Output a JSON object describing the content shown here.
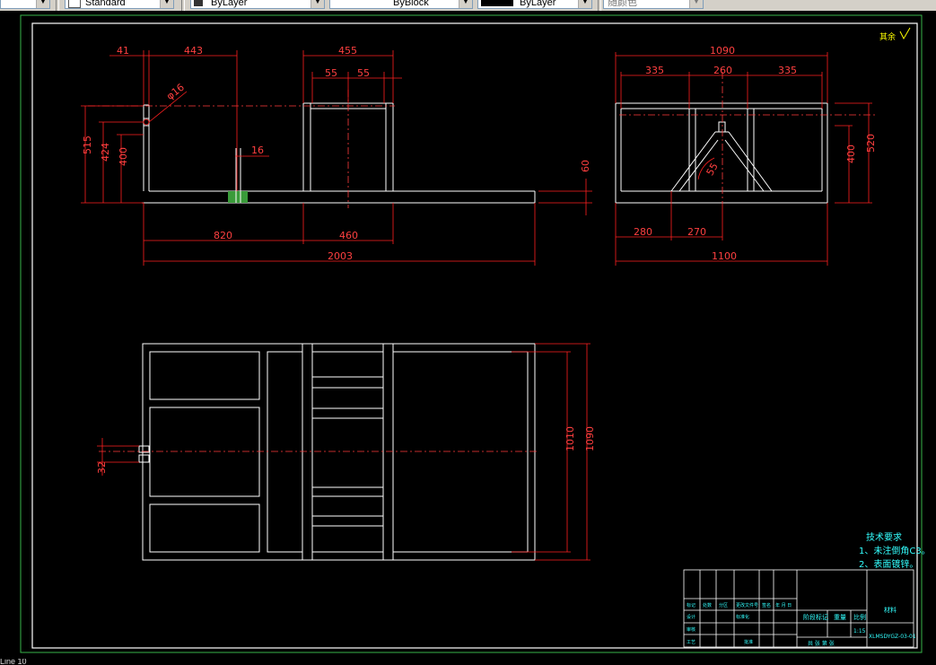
{
  "toolbar": {
    "text_style": "Standard",
    "layer": "ByLayer",
    "linetype": "ByBlock",
    "lineweight": "ByLayer",
    "plotstyle": "随颜色"
  },
  "drawing": {
    "roughness_mark": "其余",
    "dims_front": {
      "d41": "41",
      "d443": "443",
      "d455": "455",
      "d55a": "55",
      "d55b": "55",
      "phi": "φ16",
      "d16": "16",
      "d515": "515",
      "d424": "424",
      "d400": "400",
      "d60": "60",
      "d820": "820",
      "d460": "460",
      "d2003": "2003"
    },
    "dims_side": {
      "d1090": "1090",
      "d335a": "335",
      "d260": "260",
      "d335b": "335",
      "d400": "400",
      "d520": "520",
      "d55": "55",
      "d280": "280",
      "d270": "270",
      "d1100": "1100"
    },
    "dims_plan": {
      "d32": "32",
      "d1010": "1010",
      "d1090": "1090"
    },
    "tech_req": {
      "title": "技术要求",
      "line1": "1、未注倒角C3。",
      "line2": "2、表面镀锌。"
    },
    "title_block": {
      "row_labels": [
        "标记",
        "处数",
        "分区",
        "更改文件号",
        "签名",
        "年 月 日"
      ],
      "design": "设计",
      "std": "标准化",
      "review": "审核",
      "process": "工艺",
      "approve": "批准",
      "stage": "阶段标记",
      "weight": "重量",
      "scale": "比例",
      "scale_value": "1:15",
      "sheets": "共  张  第  张",
      "part_no": "XLMSDYGZ-03-01",
      "material": "材料"
    }
  },
  "cmdline": "Line 10"
}
